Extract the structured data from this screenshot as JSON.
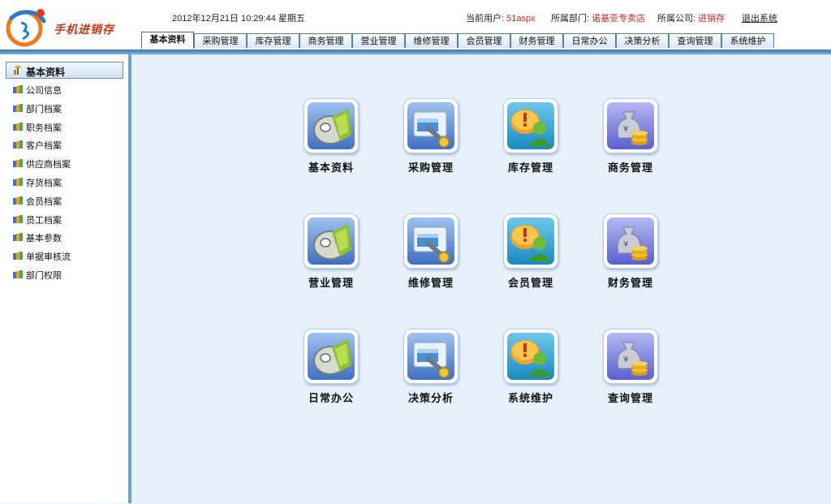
{
  "app": {
    "logo_text": "手机进销存",
    "logo_mark": "3i-logo"
  },
  "header": {
    "datetime": "2012年12月21日 10:29:44 星期五",
    "user_label": "当前用户:",
    "user_value": "51aspx",
    "dept_label": "所属部门:",
    "dept_value": "诺基亚专卖店",
    "company_label": "所属公司:",
    "company_value": "进销存",
    "logout": "退出系统"
  },
  "tabs": [
    {
      "label": "基本资料",
      "active": true
    },
    {
      "label": "采购管理"
    },
    {
      "label": "库存管理"
    },
    {
      "label": "商务管理"
    },
    {
      "label": "营业管理"
    },
    {
      "label": "维修管理"
    },
    {
      "label": "会员管理"
    },
    {
      "label": "财务管理"
    },
    {
      "label": "日常办公"
    },
    {
      "label": "决策分析"
    },
    {
      "label": "查询管理"
    },
    {
      "label": "系统维护"
    }
  ],
  "sidebar": {
    "title": "基本资料",
    "items": [
      {
        "label": "公司信息"
      },
      {
        "label": "部门档案"
      },
      {
        "label": "职务档案"
      },
      {
        "label": "客户档案"
      },
      {
        "label": "供应商档案"
      },
      {
        "label": "存货档案"
      },
      {
        "label": "会员档案"
      },
      {
        "label": "员工档案"
      },
      {
        "label": "基本参数"
      },
      {
        "label": "单据审核流"
      },
      {
        "label": "部门权限"
      }
    ]
  },
  "modules": [
    {
      "label": "基本资料",
      "icon": "disk-icon"
    },
    {
      "label": "采购管理",
      "icon": "wrench-icon"
    },
    {
      "label": "库存管理",
      "icon": "user-alert-icon"
    },
    {
      "label": "商务管理",
      "icon": "money-bag-icon"
    },
    {
      "label": "营业管理",
      "icon": "disk-icon"
    },
    {
      "label": "维修管理",
      "icon": "wrench-icon"
    },
    {
      "label": "会员管理",
      "icon": "user-alert-icon"
    },
    {
      "label": "财务管理",
      "icon": "money-bag-icon"
    },
    {
      "label": "日常办公",
      "icon": "disk-icon"
    },
    {
      "label": "决策分析",
      "icon": "wrench-icon"
    },
    {
      "label": "系统维护",
      "icon": "user-alert-icon"
    },
    {
      "label": "查询管理",
      "icon": "money-bag-icon"
    }
  ],
  "colors": {
    "accent": "#3a79b4",
    "highlight": "#d0281e",
    "background": "#e6f1fc"
  }
}
